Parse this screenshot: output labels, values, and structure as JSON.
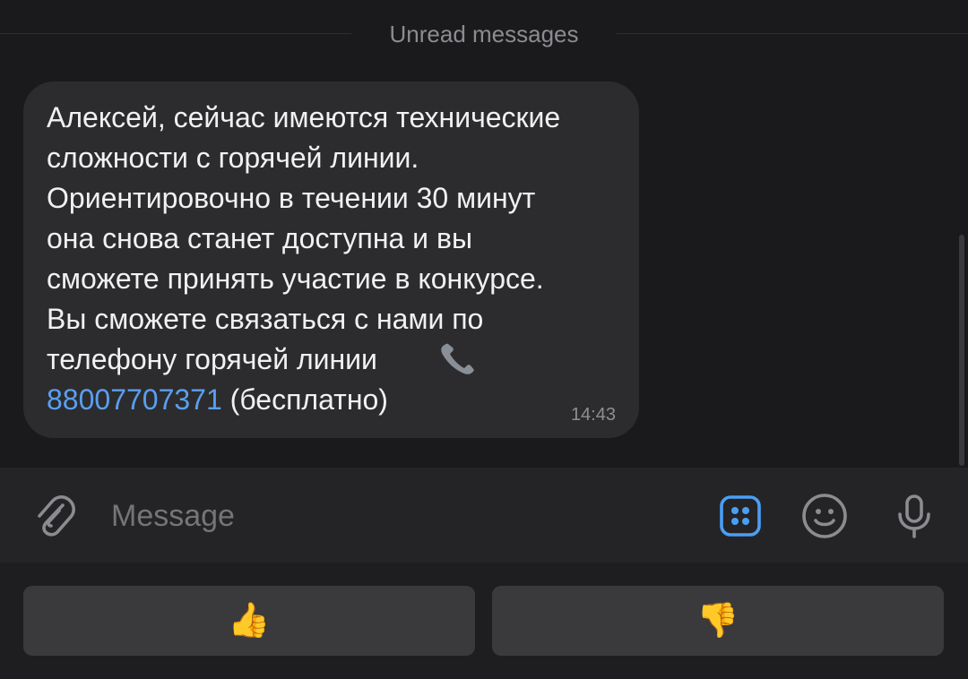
{
  "chat": {
    "divider_label": "Unread messages",
    "message": {
      "text": "Алексей, сейчас имеются технические\nсложности с горячей линии.\nОриентировочно в течении 30 минут\nона снова станет доступна и вы\nсможете принять участие в конкурсе.\nВы сможете связаться с нами по\nтелефону горячей линии",
      "phone_number": "88007707371",
      "phone_suffix": " (бесплатно)",
      "phone_icon": "telephone-receiver-icon",
      "time": "14:43"
    }
  },
  "input_bar": {
    "placeholder": "Message",
    "attach_icon": "paperclip-icon",
    "bot_commands_icon": "bot-keyboard-icon",
    "emoji_icon": "smile-icon",
    "mic_icon": "microphone-icon",
    "accent_color": "#4a9ff5"
  },
  "reply_keyboard": {
    "buttons": [
      {
        "label": "👍",
        "icon": "thumbs-up-icon"
      },
      {
        "label": "👎",
        "icon": "thumbs-down-icon"
      }
    ]
  }
}
